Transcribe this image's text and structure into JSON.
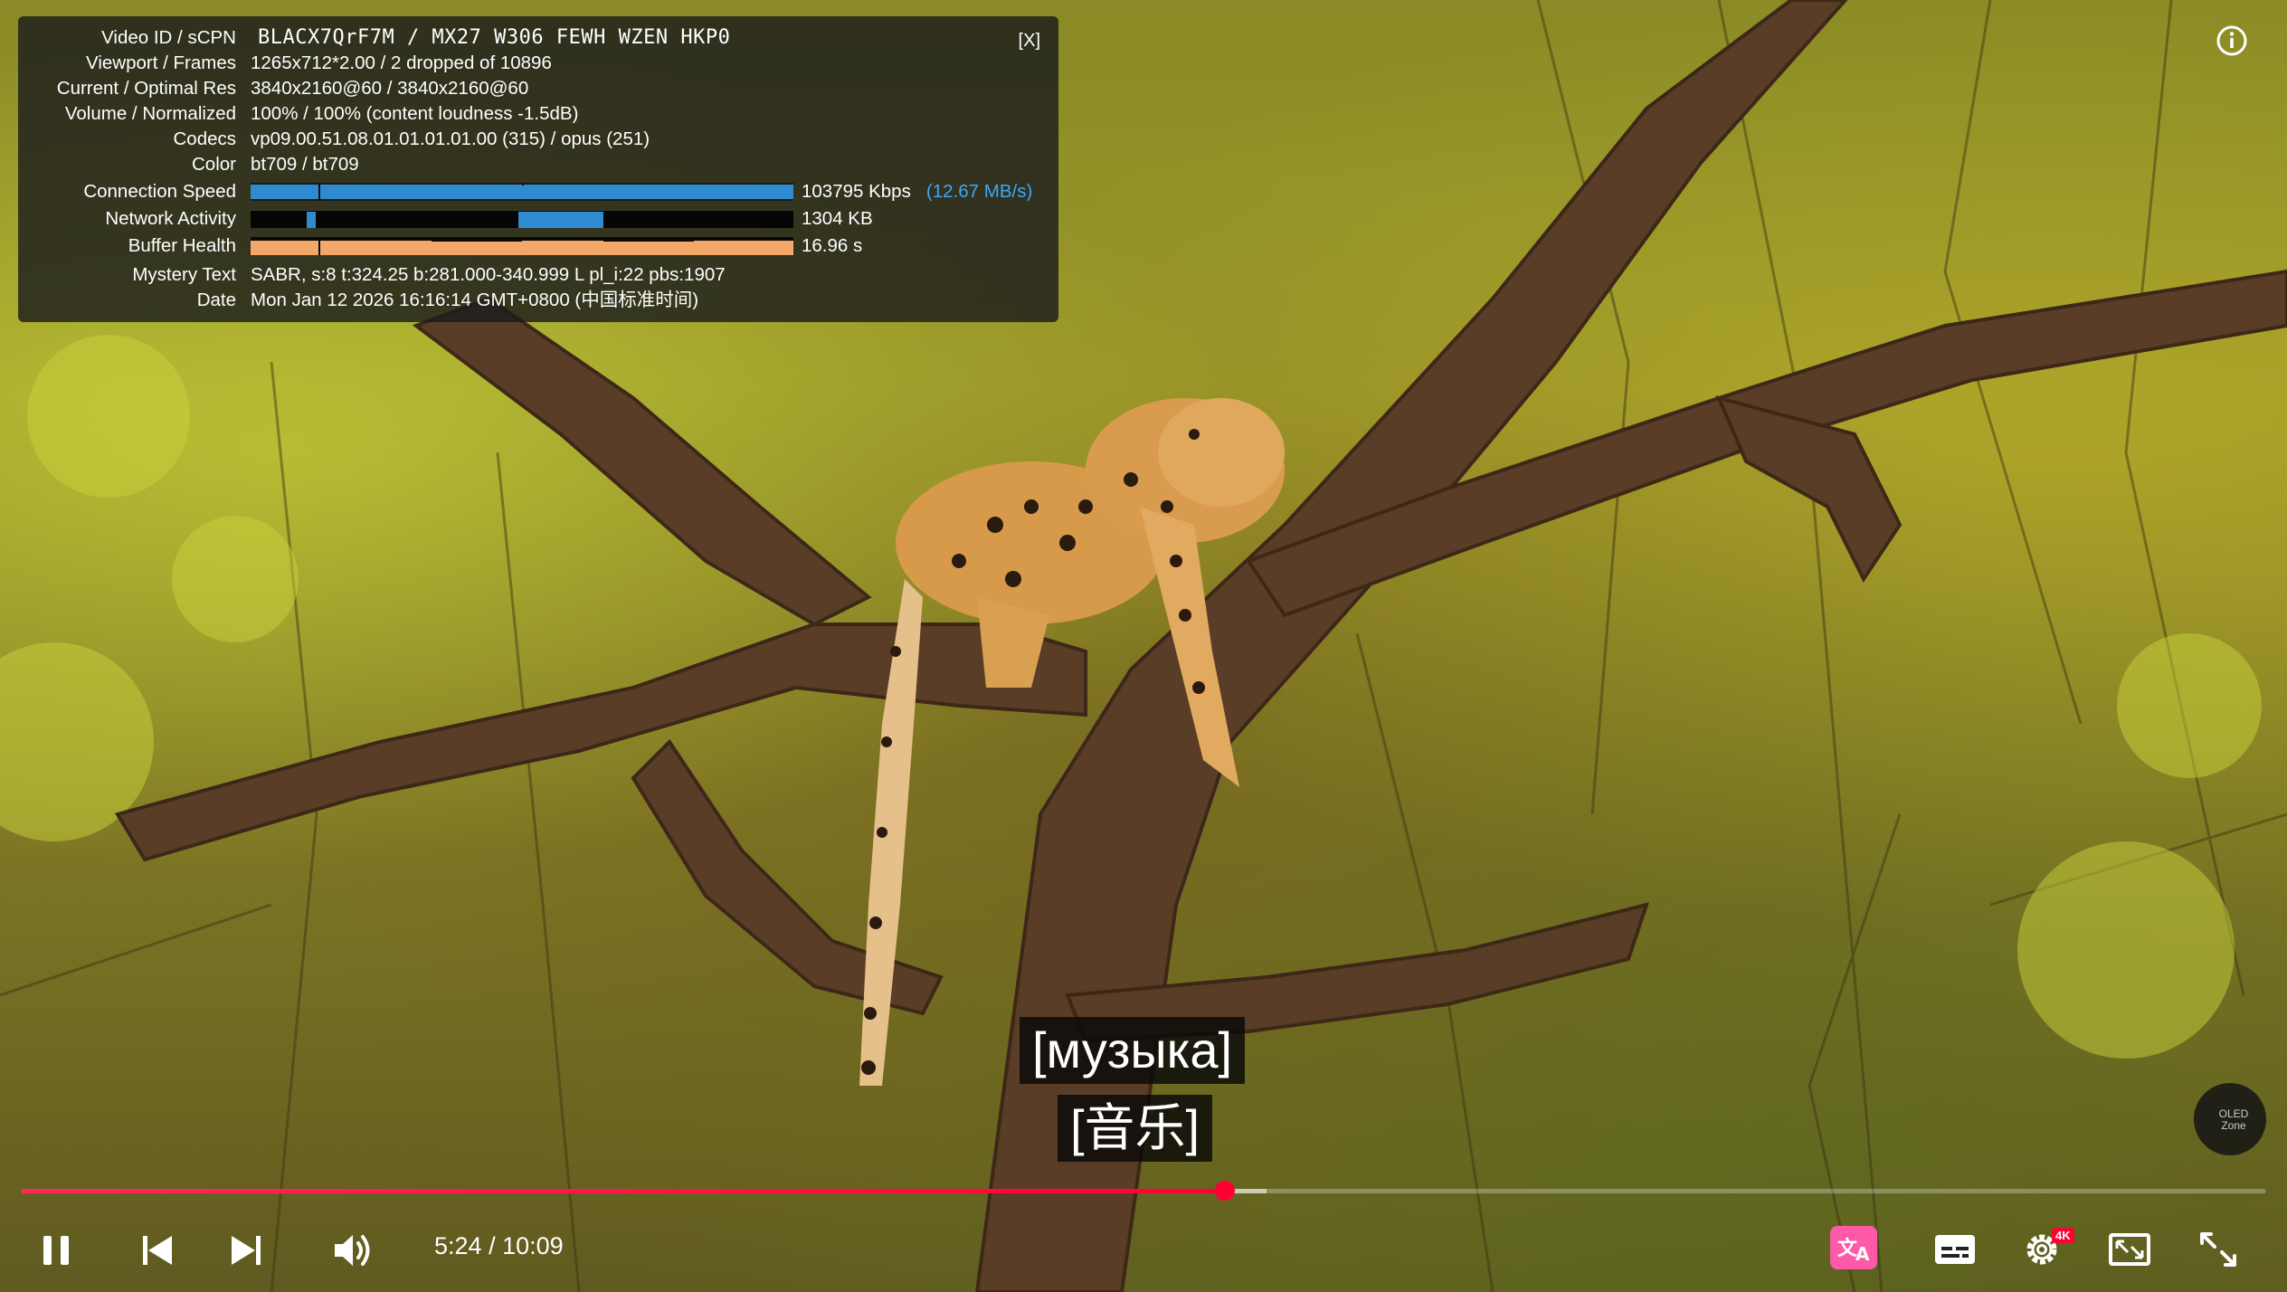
{
  "stats": {
    "close_label": "[X]",
    "rows": [
      {
        "label": "Video ID / sCPN",
        "value": "BLACX7QrF7M  /  MX27 W306 FEWH WZEN HKP0"
      },
      {
        "label": "Viewport / Frames",
        "value": "1265x712*2.00 / 2 dropped of 10896"
      },
      {
        "label": "Current / Optimal Res",
        "value": "3840x2160@60 / 3840x2160@60"
      },
      {
        "label": "Volume / Normalized",
        "value": "100% / 100% (content loudness -1.5dB)"
      },
      {
        "label": "Codecs",
        "value": "vp09.00.51.08.01.01.01.01.00 (315) / opus (251)"
      },
      {
        "label": "Color",
        "value": "bt709 / bt709"
      }
    ],
    "connection_speed": {
      "label": "Connection Speed",
      "value": "103795 Kbps",
      "mbs": "(12.67 MB/s)"
    },
    "network_activity": {
      "label": "Network Activity",
      "value": "1304 KB"
    },
    "buffer_health": {
      "label": "Buffer Health",
      "value": "16.96 s"
    },
    "mystery": {
      "label": "Mystery Text",
      "value": "SABR, s:8 t:324.25 b:281.000-340.999 L pl_i:22 pbs:1907"
    },
    "date": {
      "label": "Date",
      "value": "Mon Jan 12 2026 16:16:14 GMT+0800 (中国标准时间)"
    }
  },
  "subtitles": {
    "line1": "[музыка]",
    "line2": "[音乐]"
  },
  "progress": {
    "played_fraction": 0.5361,
    "buffered_fraction": 0.555
  },
  "time": {
    "current": "5:24",
    "separator": " / ",
    "duration": "10:09"
  },
  "badges": {
    "quality": "4K",
    "watermark": "OLED Zone"
  },
  "colors": {
    "accent": "#ff0033",
    "stats_link": "#3ea6ff",
    "speed_bar": "#2e8bd0",
    "buffer_bar": "#f3a86a"
  },
  "icons": [
    "info-icon",
    "pause-icon",
    "previous-icon",
    "next-icon",
    "volume-icon",
    "auto-translate-icon",
    "subtitles-icon",
    "settings-icon",
    "miniplayer-icon",
    "fullscreen-icon"
  ]
}
